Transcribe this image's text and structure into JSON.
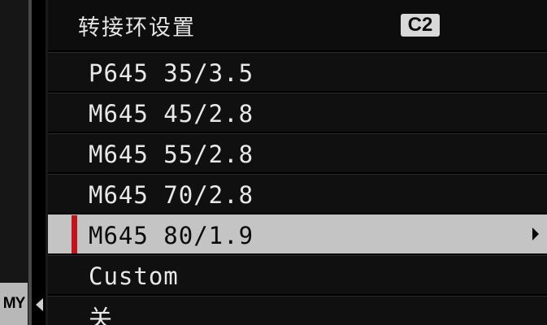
{
  "header": {
    "title": "转接环设置",
    "custom_badge": "C2"
  },
  "tab": {
    "label": "MY"
  },
  "menu": {
    "items": [
      {
        "label": "P645 35/3.5",
        "selected": false
      },
      {
        "label": "M645 45/2.8",
        "selected": false
      },
      {
        "label": "M645 55/2.8",
        "selected": false
      },
      {
        "label": "M645 70/2.8",
        "selected": false
      },
      {
        "label": "M645 80/1.9",
        "selected": true
      },
      {
        "label": "Custom",
        "selected": false
      },
      {
        "label": "关",
        "selected": false
      }
    ]
  },
  "colors": {
    "background": "#000000",
    "highlight": "#c4c4c4",
    "selection_bar": "#c0141e",
    "text": "#e8e8e8"
  },
  "icons": {
    "tab_arrow": "chevron-left-icon",
    "submenu_arrow": "chevron-right-icon"
  }
}
